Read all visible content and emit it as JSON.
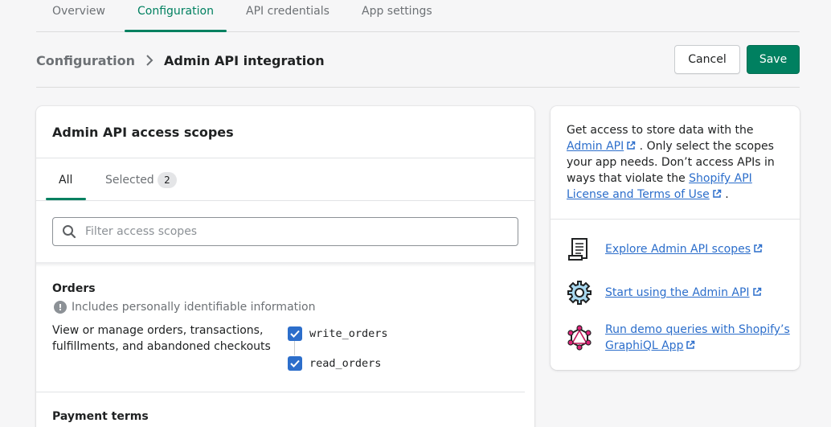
{
  "tabs": [
    {
      "label": "Overview"
    },
    {
      "label": "Configuration"
    },
    {
      "label": "API credentials"
    },
    {
      "label": "App settings"
    }
  ],
  "active_tab": "Configuration",
  "breadcrumb": {
    "parent": "Configuration",
    "current": "Admin API integration"
  },
  "actions": {
    "cancel": "Cancel",
    "save": "Save"
  },
  "scopes_card": {
    "title": "Admin API access scopes",
    "tabs": {
      "all": "All",
      "selected": "Selected",
      "selected_count": "2"
    },
    "filter": {
      "placeholder": "Filter access scopes",
      "value": ""
    },
    "sections": [
      {
        "title": "Orders",
        "pii_note": "Includes personally identifiable information",
        "description": "View or manage orders, transactions, fulfillments, and abandoned checkouts",
        "scopes": [
          {
            "name": "write_orders",
            "checked": true
          },
          {
            "name": "read_orders",
            "checked": true
          }
        ]
      },
      {
        "title": "Payment terms"
      }
    ]
  },
  "info_card": {
    "text_1": "Get access to store data with the",
    "link_1": "Admin API",
    "text_2": ". Only select the scopes your app needs. Don’t access APIs in ways that violate the",
    "link_2": "Shopify API License and Terms of Use",
    "text_3": ".",
    "resources": [
      {
        "label": "Explore Admin API scopes",
        "icon": "scroll-icon"
      },
      {
        "label": "Start using the Admin API",
        "icon": "gear-icon"
      },
      {
        "label": "Run demo queries with Shopify’s GraphiQL App",
        "icon": "graphql-icon"
      }
    ]
  },
  "colors": {
    "accent": "#008060",
    "link": "#2c6ecb",
    "checkbox": "#2c6ecb"
  }
}
